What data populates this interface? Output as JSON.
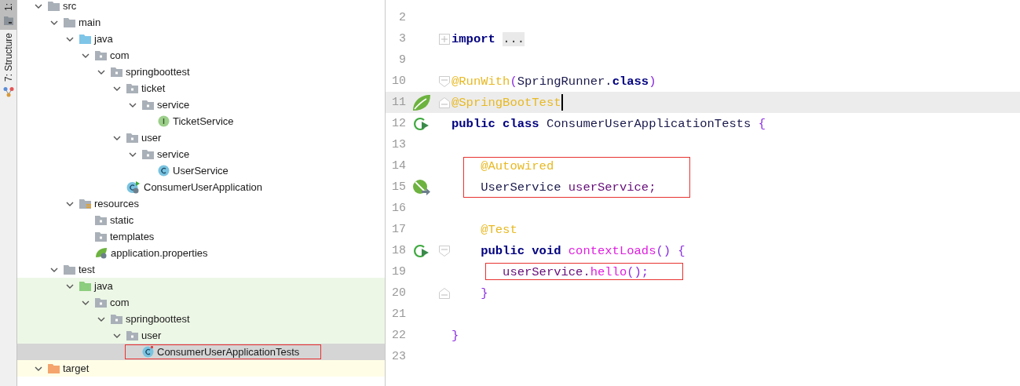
{
  "tool_strip": {
    "tabs": [
      {
        "label": "1:",
        "selected": true,
        "kind": "project"
      },
      {
        "label": "7: Structure",
        "selected": false,
        "kind": "structure"
      }
    ]
  },
  "project_tree": {
    "nodes": [
      {
        "label": "src",
        "kind": "folder",
        "expanded": true,
        "selected": false,
        "children": [
          {
            "label": "main",
            "kind": "folder",
            "expanded": true,
            "selected": false,
            "children": [
              {
                "label": "java",
                "kind": "source",
                "expanded": true,
                "selected": false,
                "children": [
                  {
                    "label": "com",
                    "kind": "package",
                    "expanded": true,
                    "selected": false,
                    "children": [
                      {
                        "label": "springboottest",
                        "kind": "package",
                        "expanded": true,
                        "selected": false,
                        "children": [
                          {
                            "label": "ticket",
                            "kind": "package",
                            "expanded": true,
                            "selected": false,
                            "children": [
                              {
                                "label": "service",
                                "kind": "package",
                                "expanded": true,
                                "selected": false,
                                "children": [
                                  {
                                    "label": "TicketService",
                                    "kind": "interface",
                                    "selected": false
                                  }
                                ]
                              }
                            ]
                          },
                          {
                            "label": "user",
                            "kind": "package",
                            "expanded": true,
                            "selected": false,
                            "children": [
                              {
                                "label": "service",
                                "kind": "package",
                                "expanded": true,
                                "selected": false,
                                "children": [
                                  {
                                    "label": "UserService",
                                    "kind": "class",
                                    "selected": false
                                  }
                                ]
                              }
                            ]
                          },
                          {
                            "label": "ConsumerUserApplication",
                            "kind": "spring-app",
                            "selected": false
                          }
                        ]
                      }
                    ]
                  }
                ]
              },
              {
                "label": "resources",
                "kind": "resources",
                "expanded": true,
                "selected": false,
                "children": [
                  {
                    "label": "static",
                    "kind": "package",
                    "selected": false
                  },
                  {
                    "label": "templates",
                    "kind": "package",
                    "selected": false
                  },
                  {
                    "label": "application.properties",
                    "kind": "properties",
                    "selected": false
                  }
                ]
              }
            ]
          },
          {
            "label": "test",
            "kind": "folder",
            "expanded": true,
            "selected": false,
            "children": [
              {
                "label": "java",
                "kind": "test-source",
                "expanded": true,
                "selected": false,
                "children": [
                  {
                    "label": "com",
                    "kind": "package",
                    "expanded": true,
                    "selected": false,
                    "children": [
                      {
                        "label": "springboottest",
                        "kind": "package",
                        "expanded": true,
                        "selected": false,
                        "children": [
                          {
                            "label": "user",
                            "kind": "package",
                            "expanded": true,
                            "selected": false,
                            "children": [
                              {
                                "label": "ConsumerUserApplicationTests",
                                "kind": "test-class",
                                "selected": true,
                                "boxed": true
                              }
                            ]
                          }
                        ]
                      }
                    ]
                  }
                ]
              }
            ]
          }
        ]
      },
      {
        "label": "target",
        "kind": "excluded",
        "expanded": true,
        "selected": false
      }
    ]
  },
  "editor": {
    "lines": [
      {
        "number": "2",
        "kind": "top"
      },
      {
        "number": "3",
        "kind": "top",
        "fold": {
          "kind": "collapsed"
        },
        "tokens": [
          {
            "text": "import ",
            "kind": "keyword"
          },
          {
            "text": "...",
            "kind": "folded"
          }
        ]
      },
      {
        "number": "9",
        "kind": "top"
      },
      {
        "number": "10",
        "kind": "top",
        "fold": {
          "kind": "start"
        },
        "tokens": [
          {
            "text": "@RunWith",
            "kind": "annotation"
          },
          {
            "text": "(",
            "kind": "punct"
          },
          {
            "text": "SpringRunner.",
            "kind": "plain"
          },
          {
            "text": "class",
            "kind": "keyword"
          },
          {
            "text": ")",
            "kind": "punct"
          }
        ]
      },
      {
        "number": "11",
        "kind": "top",
        "fold": {
          "kind": "end"
        },
        "gutter": {
          "kind": "leaf"
        },
        "current": true,
        "caret": true,
        "tokens": [
          {
            "text": "@SpringBootTest",
            "kind": "annotation"
          }
        ]
      },
      {
        "number": "12",
        "kind": "top",
        "gutter": {
          "kind": "run"
        },
        "tokens": [
          {
            "text": "public class ",
            "kind": "keyword"
          },
          {
            "text": "ConsumerUserApplicationTests ",
            "kind": "plain"
          },
          {
            "text": "{",
            "kind": "punct"
          }
        ]
      },
      {
        "number": "13",
        "kind": "top"
      },
      {
        "number": "14",
        "kind": "member",
        "boxed": true,
        "tokens": [
          {
            "text": "@Autowired",
            "kind": "annotation"
          }
        ]
      },
      {
        "number": "15",
        "kind": "member",
        "boxed": true,
        "gutter": {
          "kind": "bean"
        },
        "tokens": [
          {
            "text": "UserService ",
            "kind": "plain"
          },
          {
            "text": "userService;",
            "kind": "field"
          }
        ]
      },
      {
        "number": "16",
        "kind": "top"
      },
      {
        "number": "17",
        "kind": "member",
        "tokens": [
          {
            "text": "@Test",
            "kind": "annotation"
          }
        ]
      },
      {
        "number": "18",
        "kind": "member",
        "fold": {
          "kind": "start"
        },
        "gutter": {
          "kind": "run"
        },
        "tokens": [
          {
            "text": "public void ",
            "kind": "keyword"
          },
          {
            "text": "contextLoads",
            "kind": "method"
          },
          {
            "text": "() {",
            "kind": "punct"
          }
        ]
      },
      {
        "number": "19",
        "kind": "statement",
        "boxed": true,
        "tokens": [
          {
            "text": "userService.",
            "kind": "field"
          },
          {
            "text": "hello",
            "kind": "method"
          },
          {
            "text": "();",
            "kind": "punct"
          }
        ]
      },
      {
        "number": "20",
        "kind": "member",
        "fold": {
          "kind": "end"
        },
        "tokens": [
          {
            "text": "}",
            "kind": "punct"
          }
        ]
      },
      {
        "number": "21",
        "kind": "top"
      },
      {
        "number": "22",
        "kind": "top",
        "tokens": [
          {
            "text": "}",
            "kind": "punct"
          }
        ]
      },
      {
        "number": "23",
        "kind": "top"
      }
    ]
  }
}
